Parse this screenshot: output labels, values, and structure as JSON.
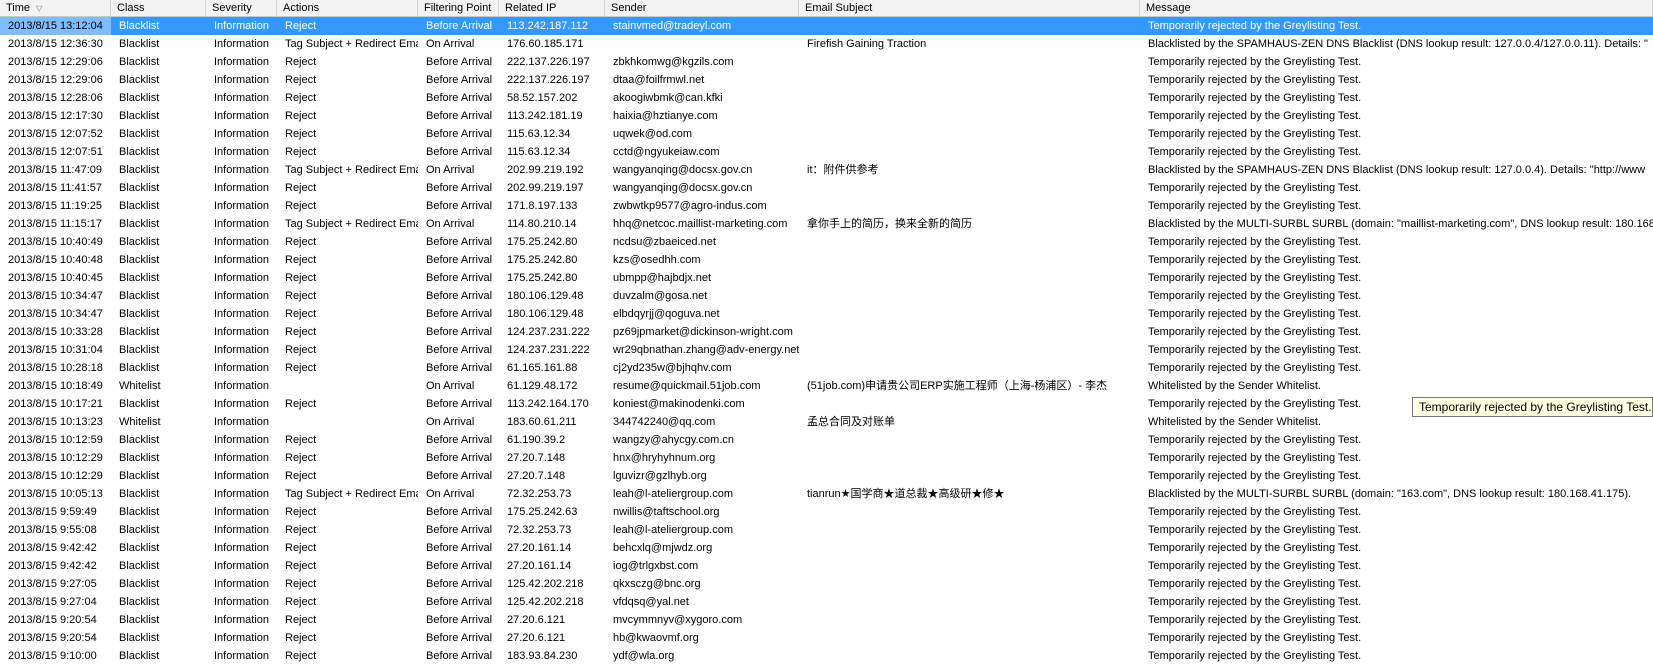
{
  "columns": [
    "Time",
    "Class",
    "Severity",
    "Actions",
    "Filtering Point",
    "Related IP",
    "Sender",
    "Email Subject",
    "Message"
  ],
  "sort_icon": "sort-down-icon",
  "selected_row_index": 0,
  "selection_color": "#3399ff",
  "tooltip": "Temporarily rejected by the Greylisting Test.",
  "rows": [
    [
      "2013/8/15 13:12:04",
      "Blacklist",
      "Information",
      "Reject",
      "Before Arrival",
      "113.242.187.112",
      "stainvmed@tradeyl.com",
      "",
      "Temporarily rejected by the Greylisting Test."
    ],
    [
      "2013/8/15 12:36:30",
      "Blacklist",
      "Information",
      "Tag Subject + Redirect Email",
      "On Arrival",
      "176.60.185.171",
      "",
      "Firefish Gaining Traction",
      "Blacklisted by the SPAMHAUS-ZEN DNS Blacklist (DNS lookup result: 127.0.0.4/127.0.0.11). Details: \""
    ],
    [
      "2013/8/15 12:29:06",
      "Blacklist",
      "Information",
      "Reject",
      "Before Arrival",
      "222.137.226.197",
      "zbkhkomwg@kgzils.com",
      "",
      "Temporarily rejected by the Greylisting Test."
    ],
    [
      "2013/8/15 12:29:06",
      "Blacklist",
      "Information",
      "Reject",
      "Before Arrival",
      "222.137.226.197",
      "dtaa@foilfrmwl.net",
      "",
      "Temporarily rejected by the Greylisting Test."
    ],
    [
      "2013/8/15 12:28:06",
      "Blacklist",
      "Information",
      "Reject",
      "Before Arrival",
      "58.52.157.202",
      "akoogiwbmk@can.kfki",
      "",
      "Temporarily rejected by the Greylisting Test."
    ],
    [
      "2013/8/15 12:17:30",
      "Blacklist",
      "Information",
      "Reject",
      "Before Arrival",
      "113.242.181.19",
      "haixia@hztianye.com",
      "",
      "Temporarily rejected by the Greylisting Test."
    ],
    [
      "2013/8/15 12:07:52",
      "Blacklist",
      "Information",
      "Reject",
      "Before Arrival",
      "115.63.12.34",
      "uqwek@od.com",
      "",
      "Temporarily rejected by the Greylisting Test."
    ],
    [
      "2013/8/15 12:07:51",
      "Blacklist",
      "Information",
      "Reject",
      "Before Arrival",
      "115.63.12.34",
      "cctd@ngyukeiaw.com",
      "",
      "Temporarily rejected by the Greylisting Test."
    ],
    [
      "2013/8/15 11:47:09",
      "Blacklist",
      "Information",
      "Tag Subject + Redirect Email",
      "On Arrival",
      "202.99.219.192",
      "wangyanqing@docsx.gov.cn",
      "it：附件供参考",
      "Blacklisted by the SPAMHAUS-ZEN DNS Blacklist (DNS lookup result: 127.0.0.4). Details: \"http://www"
    ],
    [
      "2013/8/15 11:41:57",
      "Blacklist",
      "Information",
      "Reject",
      "Before Arrival",
      "202.99.219.197",
      "wangyanqing@docsx.gov.cn",
      "",
      "Temporarily rejected by the Greylisting Test."
    ],
    [
      "2013/8/15 11:19:25",
      "Blacklist",
      "Information",
      "Reject",
      "Before Arrival",
      "171.8.197.133",
      "zwbwtkp9577@agro-indus.com",
      "",
      "Temporarily rejected by the Greylisting Test."
    ],
    [
      "2013/8/15 11:15:17",
      "Blacklist",
      "Information",
      "Tag Subject + Redirect Email",
      "On Arrival",
      "114.80.210.14",
      "hhq@netcoc.maillist-marketing.com",
      "拿你手上的简历，换来全新的简历",
      "Blacklisted by the MULTI-SURBL SURBL (domain: \"maillist-marketing.com\", DNS lookup result: 180.168"
    ],
    [
      "2013/8/15 10:40:49",
      "Blacklist",
      "Information",
      "Reject",
      "Before Arrival",
      "175.25.242.80",
      "ncdsu@zbaeiced.net",
      "",
      "Temporarily rejected by the Greylisting Test."
    ],
    [
      "2013/8/15 10:40:48",
      "Blacklist",
      "Information",
      "Reject",
      "Before Arrival",
      "175.25.242.80",
      "kzs@osedhh.com",
      "",
      "Temporarily rejected by the Greylisting Test."
    ],
    [
      "2013/8/15 10:40:45",
      "Blacklist",
      "Information",
      "Reject",
      "Before Arrival",
      "175.25.242.80",
      "ubmpp@hajbdjx.net",
      "",
      "Temporarily rejected by the Greylisting Test."
    ],
    [
      "2013/8/15 10:34:47",
      "Blacklist",
      "Information",
      "Reject",
      "Before Arrival",
      "180.106.129.48",
      "duvzalm@gosa.net",
      "",
      "Temporarily rejected by the Greylisting Test."
    ],
    [
      "2013/8/15 10:34:47",
      "Blacklist",
      "Information",
      "Reject",
      "Before Arrival",
      "180.106.129.48",
      "elbdqyrjj@qoguva.net",
      "",
      "Temporarily rejected by the Greylisting Test."
    ],
    [
      "2013/8/15 10:33:28",
      "Blacklist",
      "Information",
      "Reject",
      "Before Arrival",
      "124.237.231.222",
      "pz69jpmarket@dickinson-wright.com",
      "",
      "Temporarily rejected by the Greylisting Test."
    ],
    [
      "2013/8/15 10:31:04",
      "Blacklist",
      "Information",
      "Reject",
      "Before Arrival",
      "124.237.231.222",
      "wr29qbnathan.zhang@adv-energy.net",
      "",
      "Temporarily rejected by the Greylisting Test."
    ],
    [
      "2013/8/15 10:28:18",
      "Blacklist",
      "Information",
      "Reject",
      "Before Arrival",
      "61.165.161.88",
      "cj2yd235w@bjhqhv.com",
      "",
      "Temporarily rejected by the Greylisting Test."
    ],
    [
      "2013/8/15 10:18:49",
      "Whitelist",
      "Information",
      "",
      "On Arrival",
      "61.129.48.172",
      "resume@quickmail.51job.com",
      "(51job.com)申请贵公司ERP实施工程师（上海-杨浦区）- 李杰",
      "Whitelisted by the Sender Whitelist."
    ],
    [
      "2013/8/15 10:17:21",
      "Blacklist",
      "Information",
      "Reject",
      "Before Arrival",
      "113.242.164.170",
      "koniest@makinodenki.com",
      "",
      "Temporarily rejected by the Greylisting Test."
    ],
    [
      "2013/8/15 10:13:23",
      "Whitelist",
      "Information",
      "",
      "On Arrival",
      "183.60.61.211",
      "344742240@qq.com",
      "孟总合同及对账单",
      "Whitelisted by the Sender Whitelist."
    ],
    [
      "2013/8/15 10:12:59",
      "Blacklist",
      "Information",
      "Reject",
      "Before Arrival",
      "61.190.39.2",
      "wangzy@ahycgy.com.cn",
      "",
      "Temporarily rejected by the Greylisting Test."
    ],
    [
      "2013/8/15 10:12:29",
      "Blacklist",
      "Information",
      "Reject",
      "Before Arrival",
      "27.20.7.148",
      "hnx@hryhyhnum.org",
      "",
      "Temporarily rejected by the Greylisting Test."
    ],
    [
      "2013/8/15 10:12:29",
      "Blacklist",
      "Information",
      "Reject",
      "Before Arrival",
      "27.20.7.148",
      "lguvizr@gzlhyb.org",
      "",
      "Temporarily rejected by the Greylisting Test."
    ],
    [
      "2013/8/15 10:05:13",
      "Blacklist",
      "Information",
      "Tag Subject + Redirect Email",
      "On Arrival",
      "72.32.253.73",
      "leah@l-ateliergroup.com",
      "tianrun★国学商★道总裁★高级研★修★",
      "Blacklisted by the MULTI-SURBL SURBL (domain: \"163.com\", DNS lookup result: 180.168.41.175)."
    ],
    [
      "2013/8/15 9:59:49",
      "Blacklist",
      "Information",
      "Reject",
      "Before Arrival",
      "175.25.242.63",
      "nwillis@taftschool.org",
      "",
      "Temporarily rejected by the Greylisting Test."
    ],
    [
      "2013/8/15 9:55:08",
      "Blacklist",
      "Information",
      "Reject",
      "Before Arrival",
      "72.32.253.73",
      "leah@l-ateliergroup.com",
      "",
      "Temporarily rejected by the Greylisting Test."
    ],
    [
      "2013/8/15 9:42:42",
      "Blacklist",
      "Information",
      "Reject",
      "Before Arrival",
      "27.20.161.14",
      "behcxlq@mjwdz.org",
      "",
      "Temporarily rejected by the Greylisting Test."
    ],
    [
      "2013/8/15 9:42:42",
      "Blacklist",
      "Information",
      "Reject",
      "Before Arrival",
      "27.20.161.14",
      "iog@trlgxbst.com",
      "",
      "Temporarily rejected by the Greylisting Test."
    ],
    [
      "2013/8/15 9:27:05",
      "Blacklist",
      "Information",
      "Reject",
      "Before Arrival",
      "125.42.202.218",
      "qkxsczg@bnc.org",
      "",
      "Temporarily rejected by the Greylisting Test."
    ],
    [
      "2013/8/15 9:27:04",
      "Blacklist",
      "Information",
      "Reject",
      "Before Arrival",
      "125.42.202.218",
      "vfdqsq@yal.net",
      "",
      "Temporarily rejected by the Greylisting Test."
    ],
    [
      "2013/8/15 9:20:54",
      "Blacklist",
      "Information",
      "Reject",
      "Before Arrival",
      "27.20.6.121",
      "mvcymmnyv@xygoro.com",
      "",
      "Temporarily rejected by the Greylisting Test."
    ],
    [
      "2013/8/15 9:20:54",
      "Blacklist",
      "Information",
      "Reject",
      "Before Arrival",
      "27.20.6.121",
      "hb@kwaovmf.org",
      "",
      "Temporarily rejected by the Greylisting Test."
    ],
    [
      "2013/8/15 9:10:00",
      "Blacklist",
      "Information",
      "Reject",
      "Before Arrival",
      "183.93.84.230",
      "ydf@wla.org",
      "",
      "Temporarily rejected by the Greylisting Test."
    ]
  ]
}
